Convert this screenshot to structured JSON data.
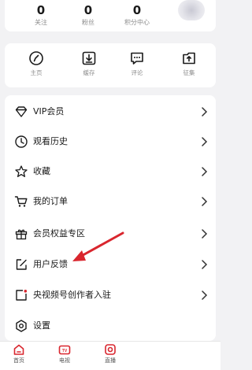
{
  "stats": {
    "items": [
      {
        "value": "0",
        "label": "关注"
      },
      {
        "value": "0",
        "label": "粉丝"
      },
      {
        "value": "0",
        "label": "积分中心"
      }
    ]
  },
  "quick_actions": {
    "items": [
      {
        "label": "主页",
        "icon": "compass-icon"
      },
      {
        "label": "缓存",
        "icon": "download-icon"
      },
      {
        "label": "评论",
        "icon": "comment-icon"
      },
      {
        "label": "征集",
        "icon": "collect-box-icon"
      }
    ]
  },
  "menu": {
    "items": [
      {
        "label": "VIP会员",
        "icon": "diamond-icon"
      },
      {
        "label": "观看历史",
        "icon": "clock-icon"
      },
      {
        "label": "收藏",
        "icon": "star-icon"
      },
      {
        "label": "我的订单",
        "icon": "cart-icon"
      },
      {
        "label": "会员权益专区",
        "icon": "gift-icon"
      },
      {
        "label": "用户反馈",
        "icon": "edit-icon"
      },
      {
        "label": "央视频号创作者入驻",
        "icon": "creator-icon"
      },
      {
        "label": "设置",
        "icon": "settings-icon"
      }
    ]
  },
  "bottom_nav": {
    "items": [
      {
        "label": "首页",
        "icon": "home-icon"
      },
      {
        "label": "电视",
        "icon": "tv-icon"
      },
      {
        "label": "直播",
        "icon": "live-icon"
      }
    ]
  },
  "colors": {
    "accent_red": "#d9262e",
    "background": "#f2f2f4",
    "card": "#ffffff",
    "muted_text": "#8c8c8c"
  }
}
